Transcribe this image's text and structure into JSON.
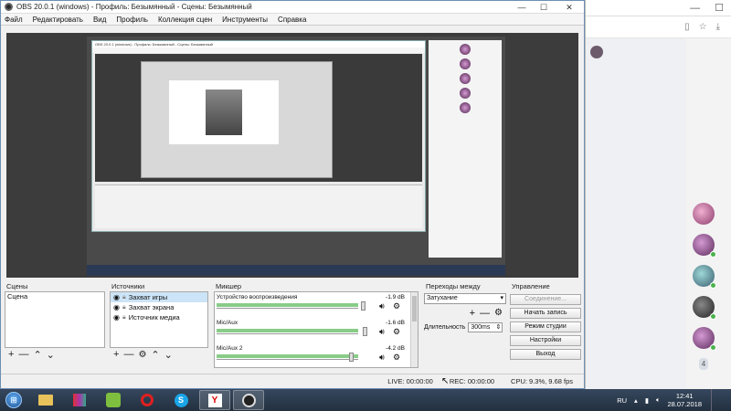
{
  "window": {
    "title": "OBS 20.0.1 (windows) - Профиль: Безымянный - Сцены: Безымянный",
    "controls": {
      "minimize": "—",
      "maximize": "☐",
      "close": "✕"
    }
  },
  "menu": [
    "Файл",
    "Редактировать",
    "Вид",
    "Профиль",
    "Коллекция сцен",
    "Инструменты",
    "Справка"
  ],
  "docks": {
    "scenes": {
      "title": "Сцены",
      "items": [
        "Сцена"
      ]
    },
    "sources": {
      "title": "Источники",
      "items": [
        "Захват игры",
        "Захват экрана",
        "Источник медиа"
      ]
    },
    "mixer": {
      "title": "Микшер",
      "channels": [
        {
          "name": "Устройство воспроизведения",
          "db": "-1.9 dB",
          "level": 0.93
        },
        {
          "name": "Mic/Aux",
          "db": "-1.6 dB",
          "level": 0.94
        },
        {
          "name": "Mic/Aux 2",
          "db": "-4.2 dB",
          "level": 0.85
        }
      ]
    },
    "transitions": {
      "title": "Переходы между сценами",
      "selected": "Затухание",
      "duration_label": "Длительность",
      "duration_value": "300ms"
    },
    "controls": {
      "title": "Управление",
      "buttons": [
        "Соединение...",
        "Начать запись",
        "Режим студии",
        "Настройки",
        "Выход"
      ]
    }
  },
  "status": {
    "live": "LIVE: 00:00:00",
    "rec": "REC: 00:00:00",
    "cpu": "CPU: 9.3%, 9.68 fps"
  },
  "tray": {
    "lang": "RU",
    "time": "12:41",
    "date": "28.07.2018"
  },
  "browser": {
    "count_badge": "4"
  }
}
